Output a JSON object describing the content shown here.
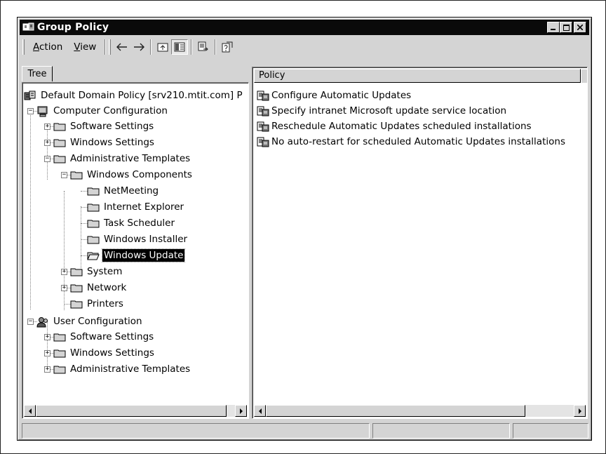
{
  "window": {
    "title": "Group Policy",
    "controls": {
      "minimize": "_",
      "maximize": "□",
      "close": "×"
    }
  },
  "menubar": {
    "items": [
      {
        "label_pre": "",
        "accel": "A",
        "label_post": "ction"
      },
      {
        "label_pre": "",
        "accel": "V",
        "label_post": "iew"
      }
    ],
    "toolbar_icons": [
      "back-arrow-icon",
      "forward-arrow-icon",
      "up-one-level-icon",
      "show-hide-tree-icon",
      "export-list-icon",
      "help-icon"
    ]
  },
  "tree_tab": {
    "label": "Tree"
  },
  "tree": {
    "root": "Default Domain Policy [srv210.mtit.com] P",
    "computer_config": "Computer Configuration",
    "cc_software": "Software Settings",
    "cc_windows": "Windows Settings",
    "cc_admin": "Administrative Templates",
    "windows_components": "Windows Components",
    "netmeeting": "NetMeeting",
    "ie": "Internet Explorer",
    "task_scheduler": "Task Scheduler",
    "windows_installer": "Windows Installer",
    "windows_update": "Windows Update",
    "system": "System",
    "network": "Network",
    "printers": "Printers",
    "user_config": "User Configuration",
    "uc_software": "Software Settings",
    "uc_windows": "Windows Settings",
    "uc_admin": "Administrative Templates"
  },
  "policy_list": {
    "column_header": "Policy",
    "items": [
      "Configure Automatic Updates",
      "Specify intranet Microsoft update service location",
      "Reschedule Automatic Updates scheduled installations",
      "No auto-restart for scheduled Automatic Updates installations"
    ]
  },
  "colors": {
    "titlebar": "#0a0a0a",
    "face": "#d4d4d4",
    "selection": "#000000"
  }
}
